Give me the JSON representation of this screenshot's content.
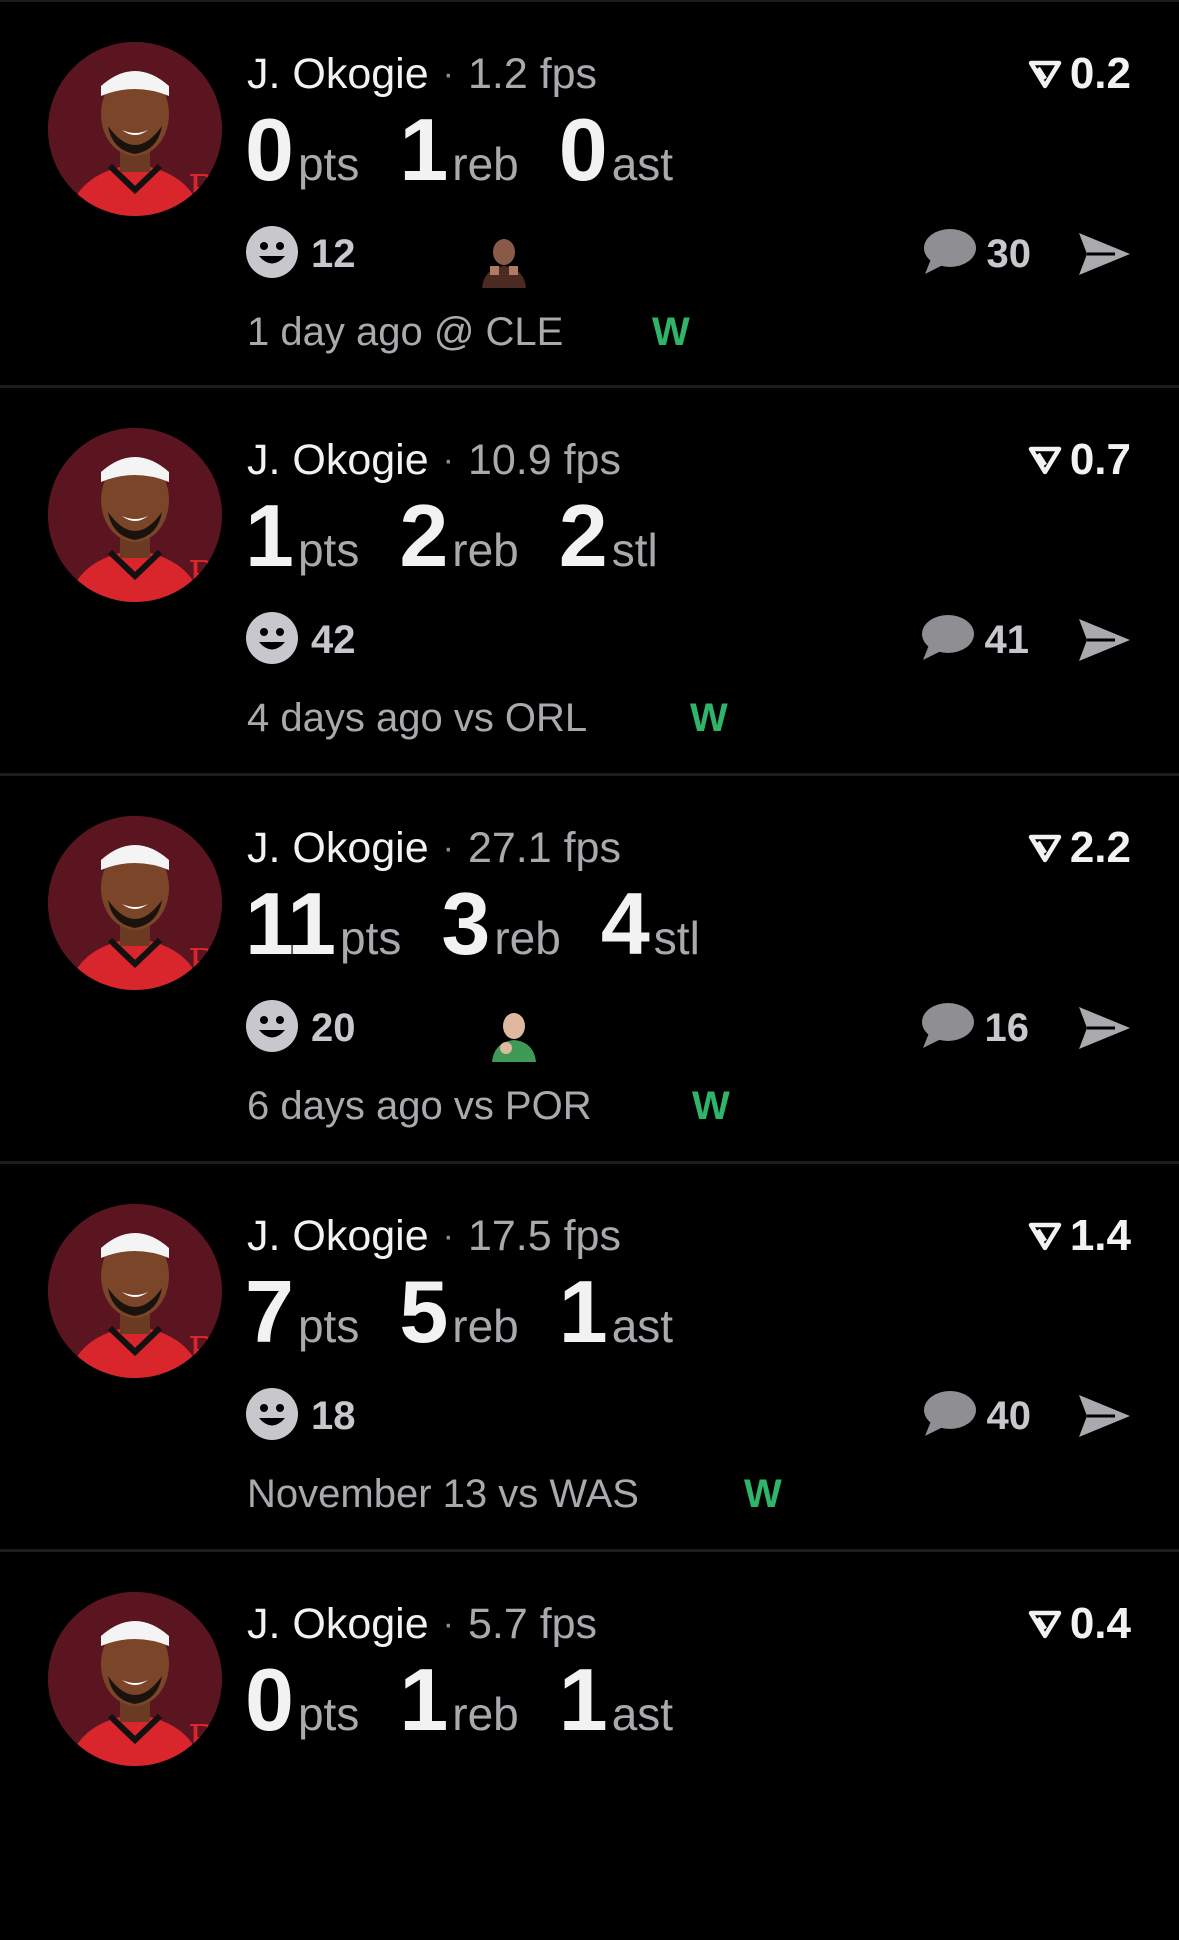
{
  "colors": {
    "background": "#000000",
    "divider": "#1c1c1e",
    "win": "#2eb56a",
    "muted": "#a9a9ae",
    "avatar_bg": "#5a1520"
  },
  "posts": [
    {
      "player": "J. Okogie",
      "fps": "1.2 fps",
      "rating": "0.2",
      "stats": [
        {
          "value": "0",
          "unit": "pts"
        },
        {
          "value": "1",
          "unit": "reb"
        },
        {
          "value": "0",
          "unit": "ast"
        }
      ],
      "reactions": "12",
      "thumbnail": "reaction-image",
      "comments": "30",
      "time_opponent": "1 day ago @ CLE",
      "result": "W"
    },
    {
      "player": "J. Okogie",
      "fps": "10.9 fps",
      "rating": "0.7",
      "stats": [
        {
          "value": "1",
          "unit": "pts"
        },
        {
          "value": "2",
          "unit": "reb"
        },
        {
          "value": "2",
          "unit": "stl"
        }
      ],
      "reactions": "42",
      "thumbnail": null,
      "comments": "41",
      "time_opponent": "4 days ago vs ORL",
      "result": "W"
    },
    {
      "player": "J. Okogie",
      "fps": "27.1 fps",
      "rating": "2.2",
      "stats": [
        {
          "value": "11",
          "unit": "pts"
        },
        {
          "value": "3",
          "unit": "reb"
        },
        {
          "value": "4",
          "unit": "stl"
        }
      ],
      "reactions": "20",
      "thumbnail": "reaction-image",
      "comments": "16",
      "time_opponent": "6 days ago vs POR",
      "result": "W"
    },
    {
      "player": "J. Okogie",
      "fps": "17.5 fps",
      "rating": "1.4",
      "stats": [
        {
          "value": "7",
          "unit": "pts"
        },
        {
          "value": "5",
          "unit": "reb"
        },
        {
          "value": "1",
          "unit": "ast"
        }
      ],
      "reactions": "18",
      "thumbnail": null,
      "comments": "40",
      "time_opponent": "November 13 vs WAS",
      "result": "W"
    },
    {
      "player": "J. Okogie",
      "fps": "5.7 fps",
      "rating": "0.4",
      "stats": [
        {
          "value": "0",
          "unit": "pts"
        },
        {
          "value": "1",
          "unit": "reb"
        },
        {
          "value": "1",
          "unit": "ast"
        }
      ],
      "reactions": "",
      "thumbnail": null,
      "comments": "",
      "time_opponent": "",
      "result": ""
    }
  ]
}
